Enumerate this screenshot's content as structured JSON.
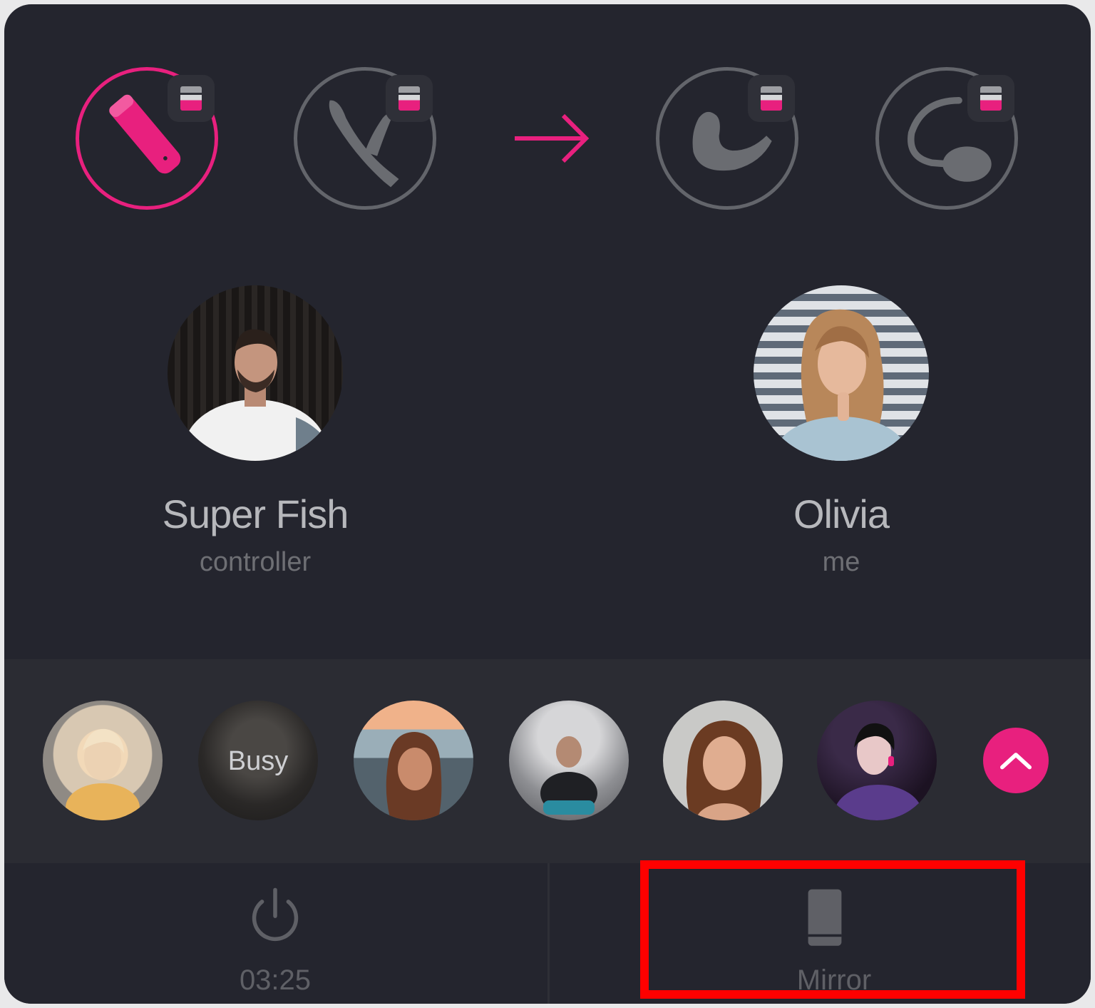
{
  "colors": {
    "accent": "#e8207e",
    "panel": "#24252e",
    "friends_strip": "#2b2c33",
    "inactive": "#63656b",
    "highlight": "#ff0000"
  },
  "devices": [
    {
      "name": "bullet-vibrator-icon",
      "active": true
    },
    {
      "name": "rabbit-vibrator-icon",
      "active": false
    },
    {
      "name": "prostate-massager-icon",
      "active": false
    },
    {
      "name": "egg-vibrator-icon",
      "active": false
    }
  ],
  "controller": {
    "name": "Super Fish",
    "role": "controller"
  },
  "me": {
    "name": "Olivia",
    "role": "me"
  },
  "friends": [
    {
      "tag": ""
    },
    {
      "tag": "Busy"
    },
    {
      "tag": ""
    },
    {
      "tag": ""
    },
    {
      "tag": ""
    },
    {
      "tag": ""
    }
  ],
  "icons": {
    "transfer": "arrow-right-icon",
    "collapse": "chevron-up-icon",
    "power": "power-icon",
    "mirror": "phone-icon"
  },
  "footer": {
    "timer": "03:25",
    "mirror_label": "Mirror"
  }
}
